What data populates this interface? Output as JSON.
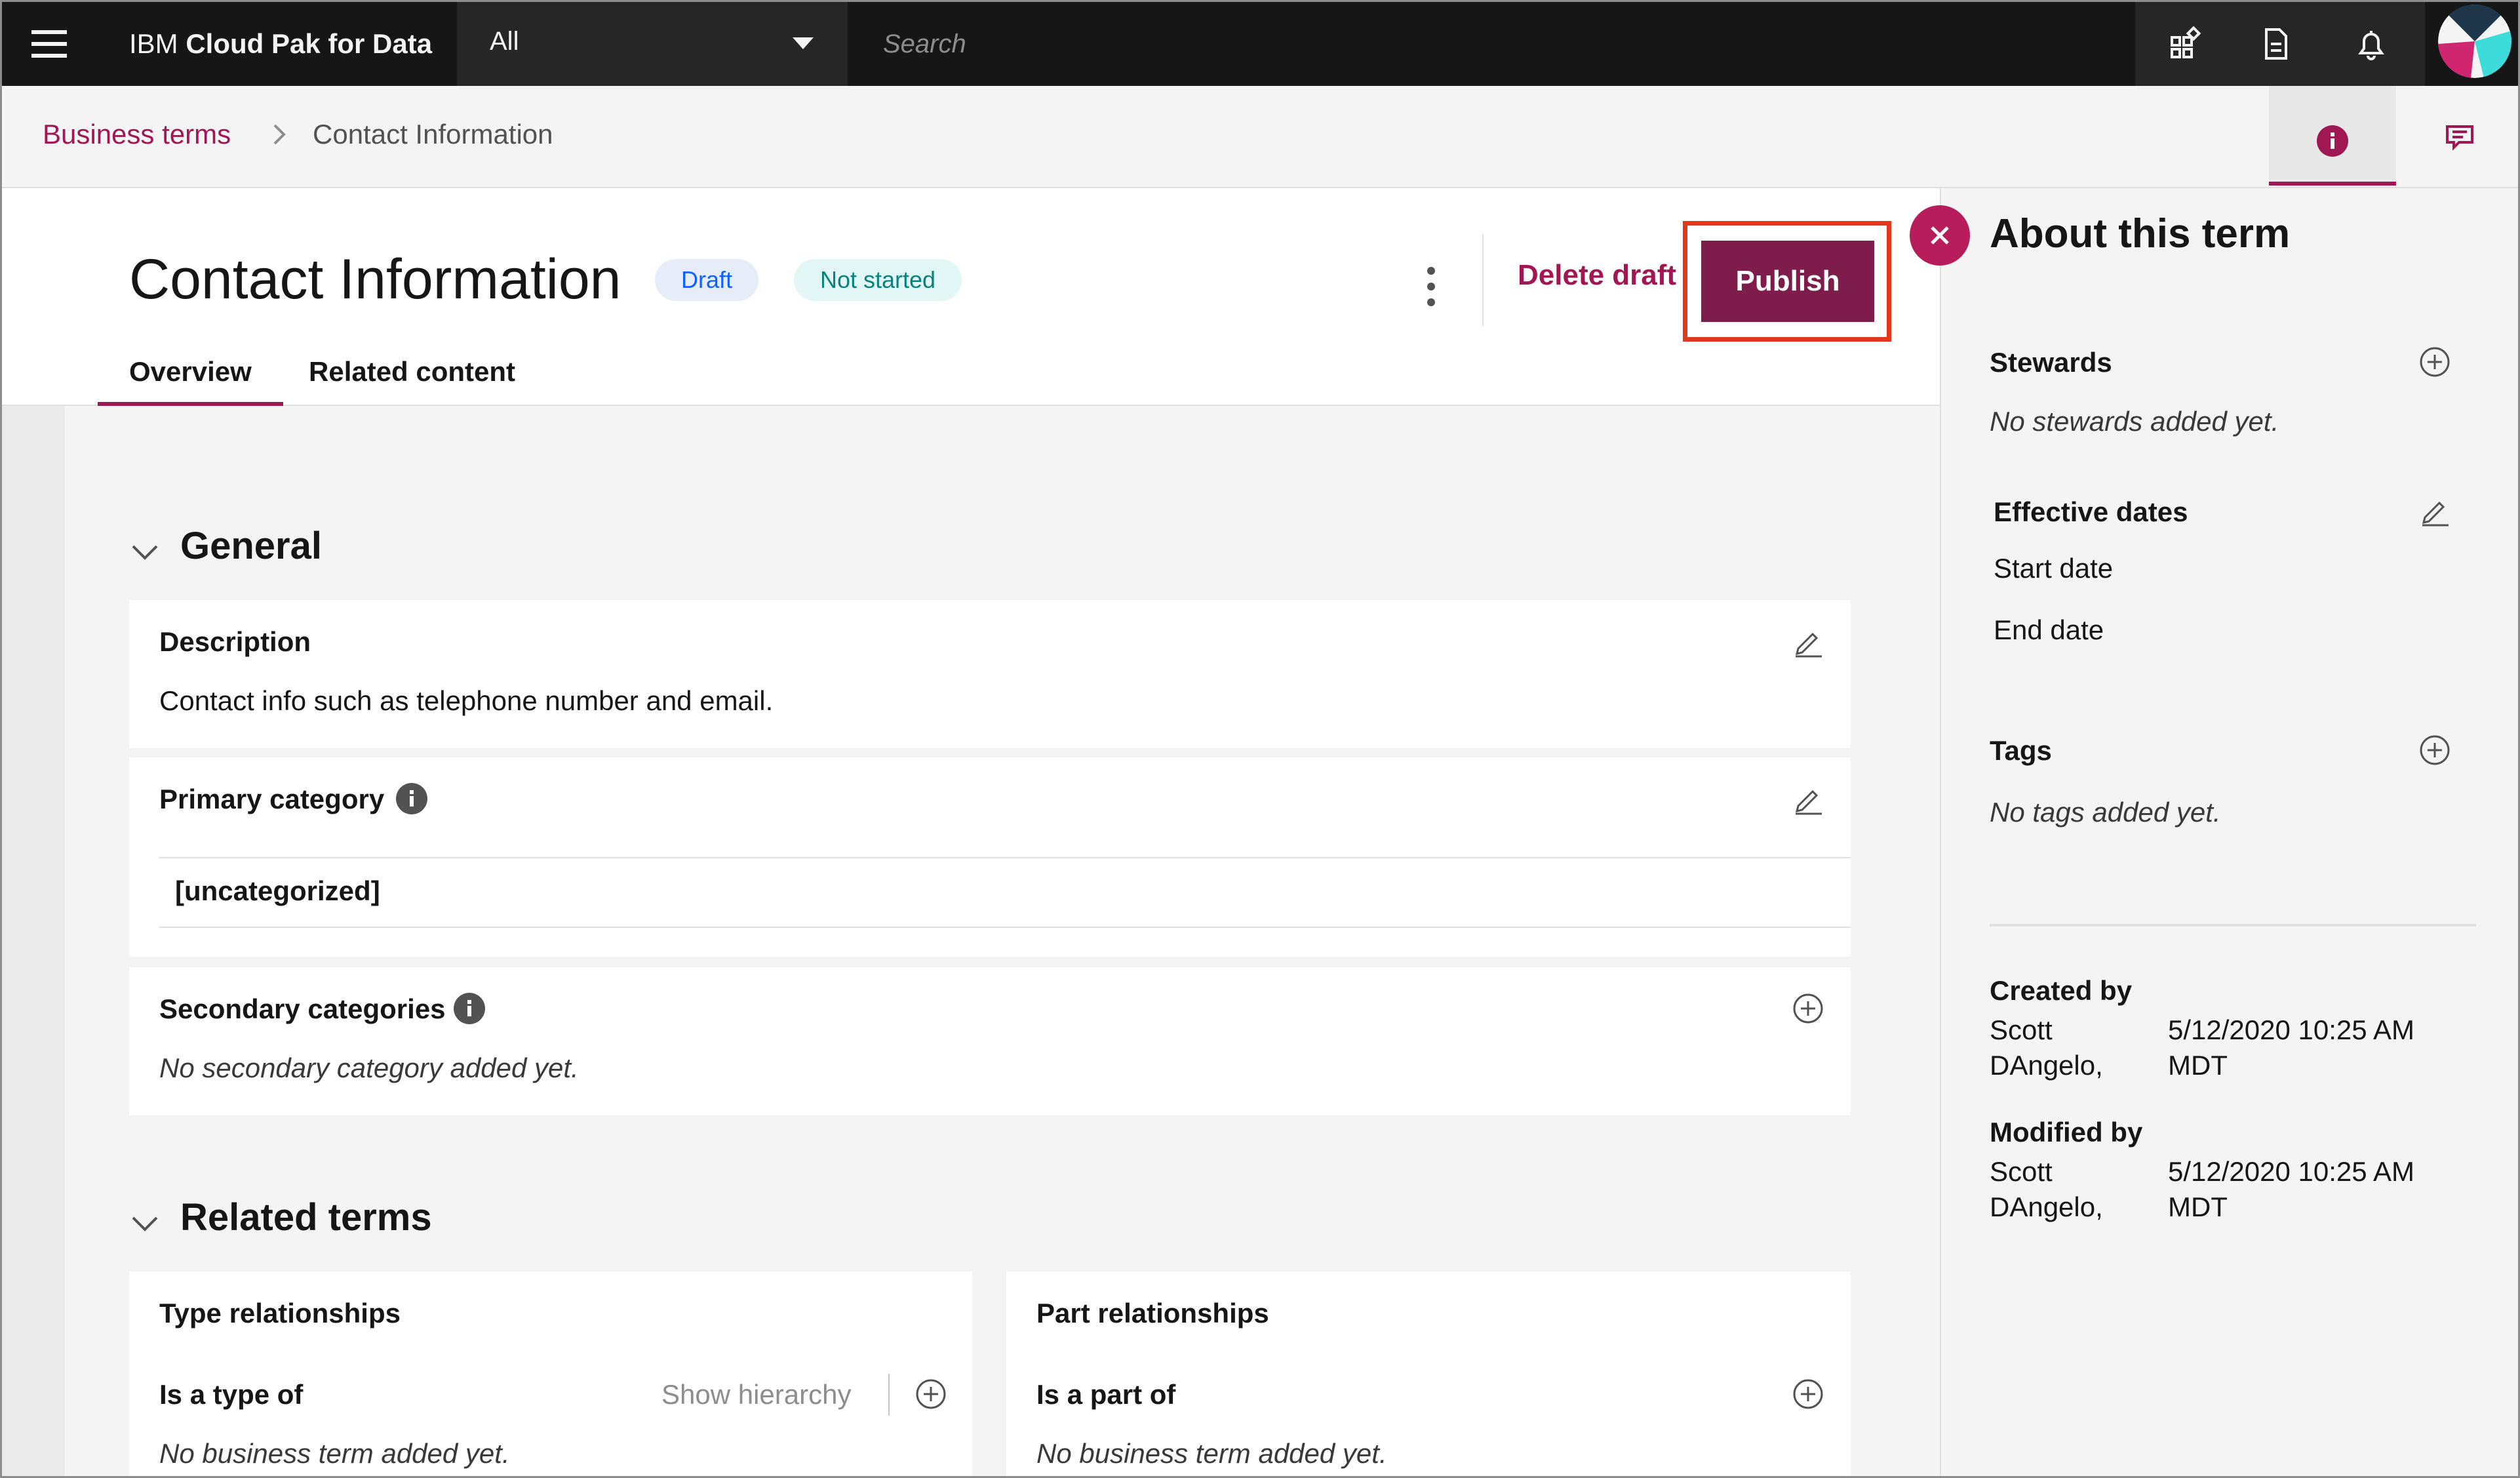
{
  "app": {
    "brand_prefix": "IBM",
    "brand_name": "Cloud Pak for Data"
  },
  "scope": {
    "selected": "All"
  },
  "search": {
    "placeholder": "Search"
  },
  "icons": {
    "menu": "hamburger-icon",
    "search": "search-icon",
    "apps": "app-switcher-icon",
    "docs": "document-icon",
    "notifications": "bell-icon",
    "info": "info-icon",
    "comments": "chat-icon",
    "close": "close-icon",
    "edit": "edit-icon",
    "add": "add-icon",
    "chevron": "chevron-down-icon",
    "breadcrumb_sep": "chevron-right-icon",
    "overflow": "overflow-menu-icon"
  },
  "colors": {
    "accent": "#9f1853",
    "publish": "#7e1c4b",
    "close": "#b81d5b",
    "highlight": "#e0391c",
    "topbar": "#161616",
    "draft_tag": "#0f62fe",
    "not_started_tag": "#08827c"
  },
  "breadcrumb": {
    "parent": "Business terms",
    "current": "Contact Information"
  },
  "header": {
    "title": "Contact Information",
    "tags": {
      "draft": "Draft",
      "status": "Not started"
    },
    "delete_draft": "Delete draft",
    "publish": "Publish",
    "tabs": {
      "overview": "Overview",
      "related": "Related content"
    }
  },
  "general": {
    "heading": "General",
    "description": {
      "label": "Description",
      "text": "Contact info such as telephone number and email."
    },
    "primary_category": {
      "label": "Primary category",
      "value": "[uncategorized]"
    },
    "secondary_categories": {
      "label": "Secondary categories",
      "empty": "No secondary category added yet."
    }
  },
  "related_terms": {
    "heading": "Related terms",
    "type_relationships": {
      "label": "Type relationships",
      "sub_label": "Is a type of",
      "show_hierarchy": "Show hierarchy",
      "empty": "No business term added yet."
    },
    "part_relationships": {
      "label": "Part relationships",
      "sub_label": "Is a part of",
      "empty": "No business term added yet."
    }
  },
  "about": {
    "title": "About this term",
    "stewards": {
      "label": "Stewards",
      "empty": "No stewards added yet."
    },
    "effective_dates": {
      "label": "Effective dates",
      "start": "Start date",
      "end": "End date"
    },
    "tags": {
      "label": "Tags",
      "empty": "No tags added yet."
    },
    "created_by": {
      "label": "Created by",
      "name_first": "Scott",
      "name_last": "DAngelo,",
      "date": "5/12/2020 10:25 AM",
      "tz": "MDT"
    },
    "modified_by": {
      "label": "Modified by",
      "name_first": "Scott",
      "name_last": "DAngelo,",
      "date": "5/12/2020 10:25 AM",
      "tz": "MDT"
    }
  }
}
